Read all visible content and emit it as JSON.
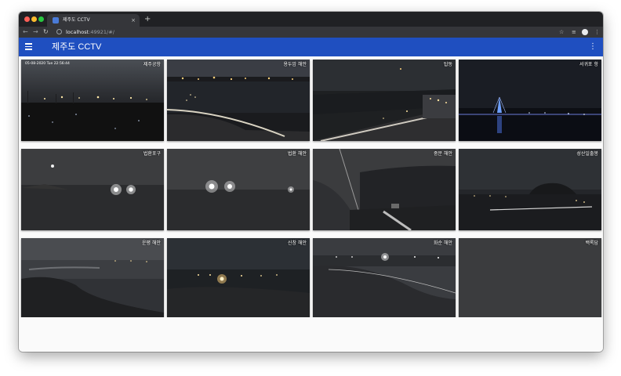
{
  "browser": {
    "tab_title": "제주도 CCTV",
    "new_tab": "+",
    "tab_close": "×",
    "url_host": "localhost",
    "url_port_path": ":49921/#/",
    "icons": [
      "back-icon",
      "forward-icon",
      "reload-icon",
      "info-icon",
      "star-icon",
      "extensions-icon",
      "profile-icon",
      "chrome-menu-icon"
    ]
  },
  "app": {
    "title": "제주도 CCTV",
    "menu_icon": "hamburger-icon",
    "more_icon": "more-vert-icon",
    "bar_color": "#1f4fc0"
  },
  "cameras": [
    {
      "label": "제주공항",
      "timestamp": "05-08-2020 Tue 22:56:44"
    },
    {
      "label": "용두암 해안"
    },
    {
      "label": "탑동"
    },
    {
      "label": "서귀포 항"
    },
    {
      "label": "법환포구"
    },
    {
      "label": "법환 해안"
    },
    {
      "label": "중문 해안"
    },
    {
      "label": "성산일출봉"
    },
    {
      "label": "운평 해안"
    },
    {
      "label": "신창 해안"
    },
    {
      "label": "화순 해안"
    },
    {
      "label": "백록담"
    }
  ]
}
